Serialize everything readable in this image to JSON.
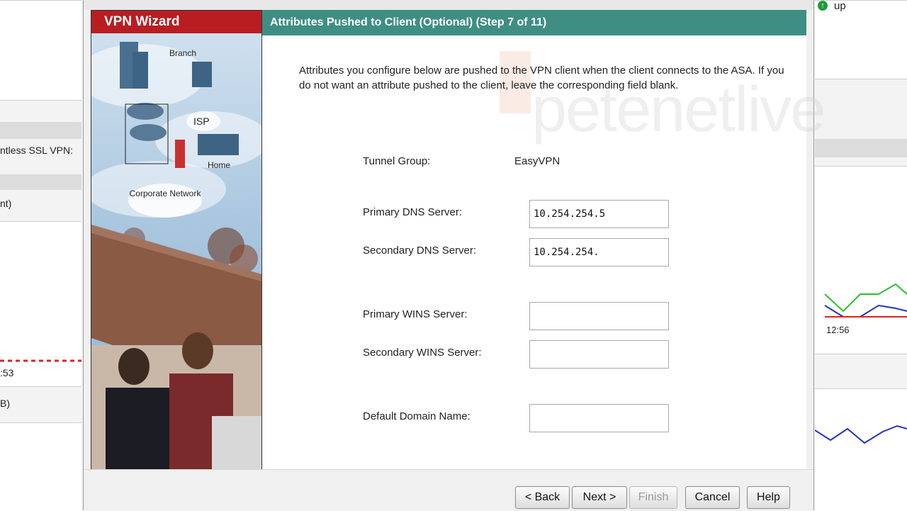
{
  "background_left": {
    "fragment_1": "ntless SSL VPN:",
    "fragment_2": "nt)",
    "fragment_3": ":53",
    "fragment_4": "B)"
  },
  "background_right": {
    "status_text": "up",
    "time_label": "12:56"
  },
  "sidebar": {
    "title": "VPN Wizard",
    "illustration_labels": {
      "branch": "Branch",
      "isp": "ISP",
      "home": "Home",
      "corporate_network": "Corporate Network"
    }
  },
  "header": {
    "title": "Attributes Pushed to Client (Optional)  (Step 7 of 11)"
  },
  "description": "Attributes you configure below are pushed to the VPN client when the client connects to the ASA. If you do not want an attribute pushed to the client, leave the corresponding field blank.",
  "form": {
    "tunnel_group_label": "Tunnel Group:",
    "tunnel_group_value": "EasyVPN",
    "primary_dns_label": "Primary DNS Server:",
    "primary_dns_value": "10.254.254.5",
    "secondary_dns_label": "Secondary DNS Server:",
    "secondary_dns_value": "10.254.254.",
    "primary_wins_label": "Primary WINS Server:",
    "primary_wins_value": "",
    "secondary_wins_label": "Secondary WINS Server:",
    "secondary_wins_value": "",
    "default_domain_label": "Default Domain Name:",
    "default_domain_value": ""
  },
  "buttons": {
    "back": "< Back",
    "next": "Next >",
    "finish": "Finish",
    "cancel": "Cancel",
    "help": "Help"
  },
  "watermark": "petenetlive",
  "colors": {
    "sidebar_title_bg": "#b81d22",
    "header_bg": "#3e8e84",
    "status_green": "#1e9a3a"
  }
}
